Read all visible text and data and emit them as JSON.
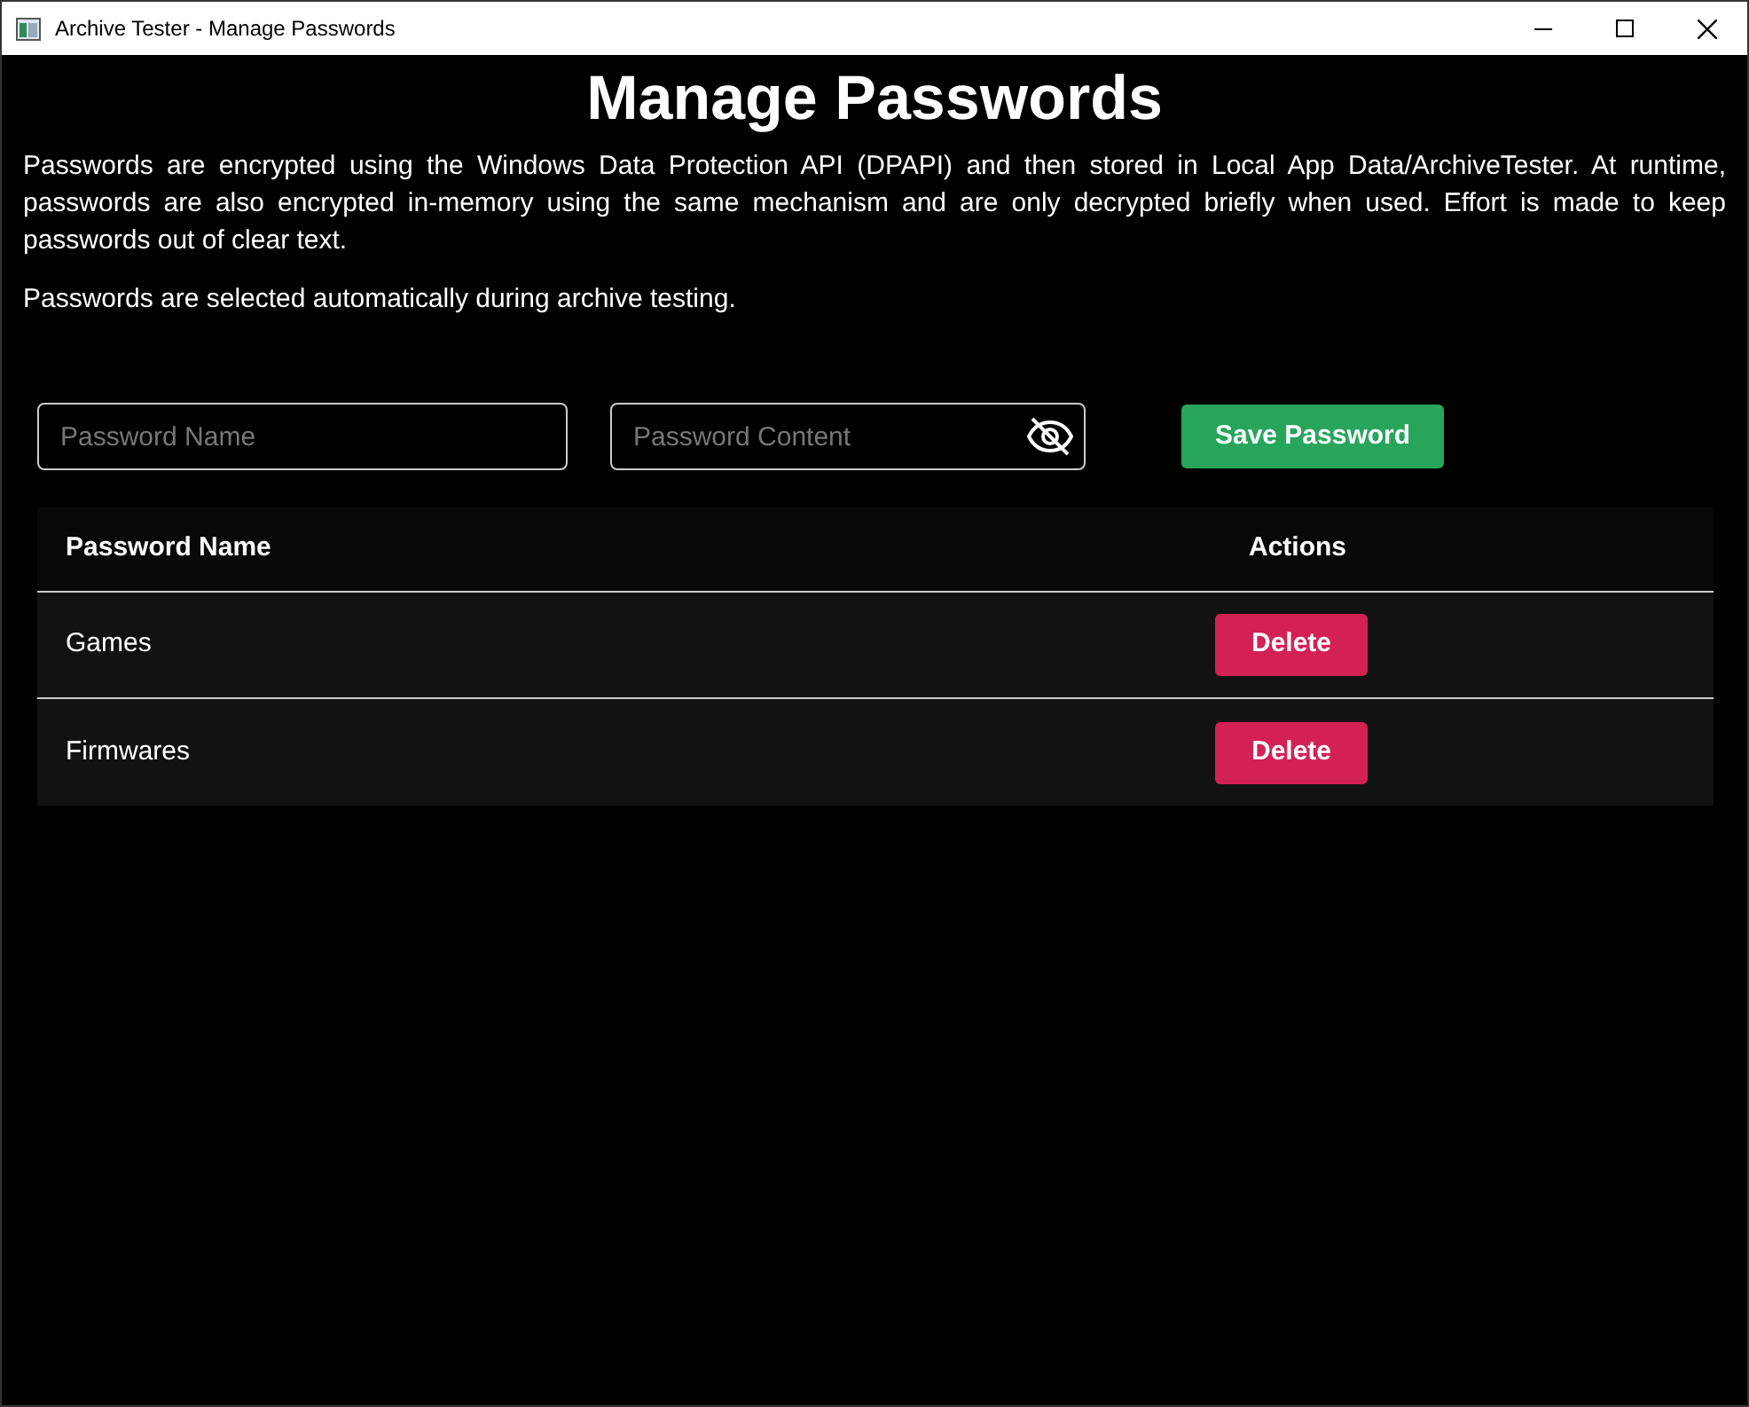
{
  "window": {
    "title": "Archive Tester - Manage Passwords"
  },
  "heading": "Manage Passwords",
  "paragraphs": [
    "Passwords are encrypted using the Windows Data Protection API (DPAPI) and then stored in Local App Data/ArchiveTester. At runtime, passwords are also encrypted in-memory using the same mechanism and are only decrypted briefly when used. Effort is made to keep passwords out of clear text.",
    "Passwords are selected automatically during archive testing."
  ],
  "form": {
    "name_field": {
      "placeholder": "Password Name"
    },
    "content_field": {
      "placeholder": "Password Content",
      "revealed": false
    },
    "save_button": "Save Password"
  },
  "table": {
    "columns": [
      "Password Name",
      "Actions"
    ],
    "rows": [
      {
        "name": "Games",
        "action": "Delete"
      },
      {
        "name": "Firmwares",
        "action": "Delete"
      }
    ]
  }
}
